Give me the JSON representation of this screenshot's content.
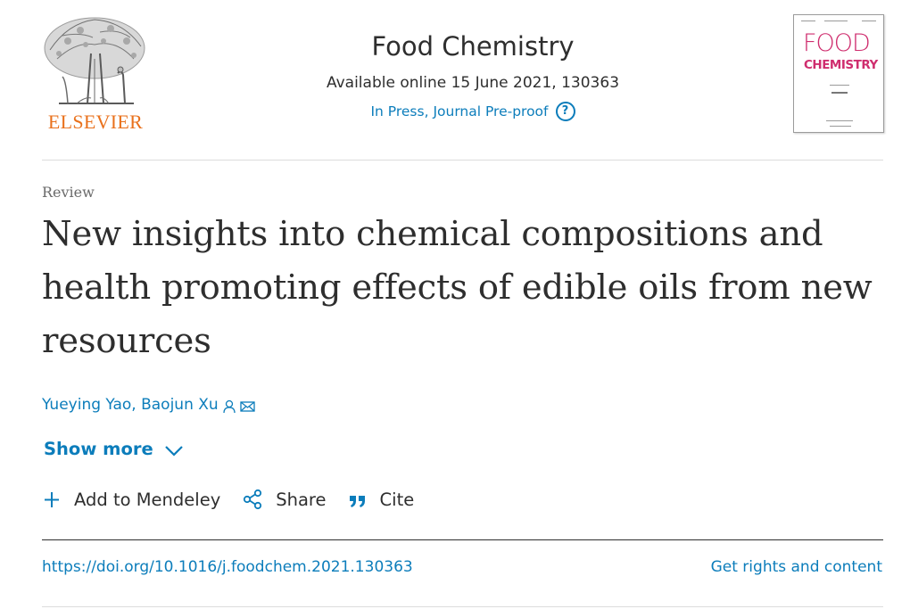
{
  "publisher": {
    "logo_icon": "elsevier-tree-logo",
    "name": "ELSEVIER"
  },
  "journal": {
    "title": "Food Chemistry",
    "availability": "Available online 15 June 2021, 130363",
    "status": "In Press, Journal Pre-proof",
    "status_icon": "help-circle-icon",
    "cover": {
      "title_line1": "FOOD",
      "title_line2": "CHEMISTRY"
    }
  },
  "article": {
    "type": "Review",
    "title": "New insights into chemical compositions and health promoting effects of edible oils from new resources",
    "authors": "Yueying Yao, Baojun Xu",
    "author_icons": [
      "person-icon",
      "mail-icon"
    ]
  },
  "show_more": {
    "label": "Show more",
    "icon": "chevron-down-icon"
  },
  "actions": [
    {
      "label": "Add to Mendeley",
      "icon": "plus-icon"
    },
    {
      "label": "Share",
      "icon": "share-icon"
    },
    {
      "label": "Cite",
      "icon": "quote-icon"
    }
  ],
  "footer": {
    "doi": "https://doi.org/10.1016/j.foodchem.2021.130363",
    "rights": "Get rights and content"
  },
  "colors": {
    "link": "#0c7dbb",
    "brand_orange": "#e9711c",
    "cover_pink": "#cf2d6e",
    "text": "#2e2e2e"
  }
}
